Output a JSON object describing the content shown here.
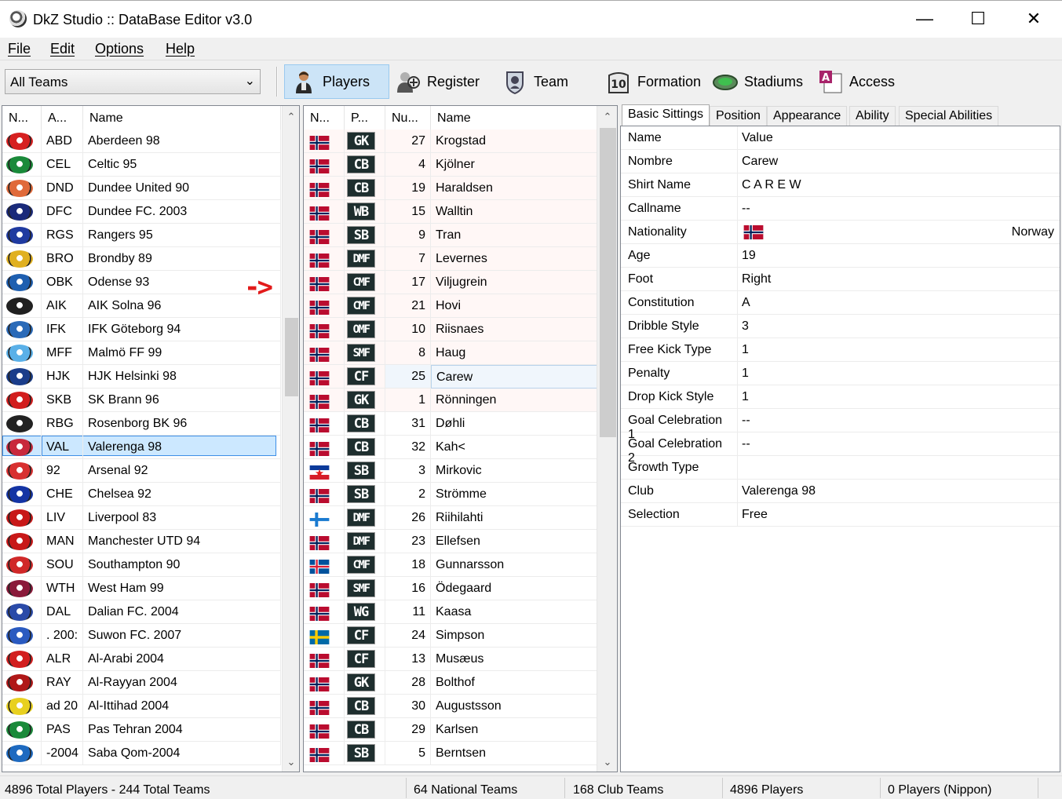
{
  "window": {
    "title": "DkZ Studio :: DataBase Editor v3.0",
    "minimize": "—",
    "maximize": "☐",
    "close": "✕"
  },
  "menu": [
    "File",
    "Edit",
    "Options",
    "Help"
  ],
  "toolbar": {
    "team_filter": "All Teams",
    "buttons": [
      {
        "label": "Players",
        "icon": "player-icon"
      },
      {
        "label": "Register",
        "icon": "register-icon"
      },
      {
        "label": "Team",
        "icon": "team-icon"
      },
      {
        "label": "Formation",
        "icon": "formation-icon"
      },
      {
        "label": "Stadiums",
        "icon": "stadium-icon"
      },
      {
        "label": "Access",
        "icon": "access-icon"
      }
    ]
  },
  "teams": {
    "columns": [
      "N...",
      "A...",
      "Name"
    ],
    "selected_index": 13,
    "rows": [
      {
        "abbr": "ABD",
        "name": "Aberdeen 98",
        "color": "#d62020"
      },
      {
        "abbr": "CEL",
        "name": "Celtic 95",
        "color": "#1a8a3a"
      },
      {
        "abbr": "DND",
        "name": "Dundee United 90",
        "color": "#e06a3a"
      },
      {
        "abbr": "DFC",
        "name": "Dundee FC. 2003",
        "color": "#1a2a7a"
      },
      {
        "abbr": "RGS",
        "name": "Rangers 95",
        "color": "#1f3aa0"
      },
      {
        "abbr": "BRO",
        "name": "Brondby 89",
        "color": "#e0b020"
      },
      {
        "abbr": "OBK",
        "name": "Odense 93",
        "color": "#1e5fb0"
      },
      {
        "abbr": "AIK",
        "name": "AIK Solna 96",
        "color": "#202020"
      },
      {
        "abbr": "IFK",
        "name": "IFK Göteborg 94",
        "color": "#2a6ab8"
      },
      {
        "abbr": "MFF",
        "name": "Malmö FF 99",
        "color": "#5ab0e8"
      },
      {
        "abbr": "HJK",
        "name": "HJK Helsinki 98",
        "color": "#1a3d8a"
      },
      {
        "abbr": "SKB",
        "name": "SK Brann 96",
        "color": "#d21e1e"
      },
      {
        "abbr": "RBG",
        "name": "Rosenborg BK 96",
        "color": "#222222"
      },
      {
        "abbr": "VAL",
        "name": "Valerenga 98",
        "color": "#c8283c"
      },
      {
        "abbr": "92",
        "name": "Arsenal 92",
        "color": "#d83030"
      },
      {
        "abbr": "CHE",
        "name": "Chelsea 92",
        "color": "#1434a4"
      },
      {
        "abbr": "LIV",
        "name": "Liverpool 83",
        "color": "#c81818"
      },
      {
        "abbr": "MAN",
        "name": "Manchester UTD 94",
        "color": "#c81818"
      },
      {
        "abbr": "SOU",
        "name": "Southampton 90",
        "color": "#d02828"
      },
      {
        "abbr": "WTH",
        "name": "West Ham 99",
        "color": "#8a1a3a"
      },
      {
        "abbr": "DAL",
        "name": "Dalian FC. 2004",
        "color": "#2a4aa8"
      },
      {
        "abbr": ". 200:",
        "name": "Suwon FC. 2007",
        "color": "#2a5ac0"
      },
      {
        "abbr": "ALR",
        "name": "Al-Arabi 2004",
        "color": "#d21e1e"
      },
      {
        "abbr": "RAY",
        "name": "Al-Rayyan 2004",
        "color": "#b01818"
      },
      {
        "abbr": "ad 20",
        "name": "Al-Ittihad 2004",
        "color": "#e8d020"
      },
      {
        "abbr": "PAS",
        "name": "Pas Tehran 2004",
        "color": "#1a8a3a"
      },
      {
        "abbr": "-2004",
        "name": "Saba Qom-2004",
        "color": "#1e6ac0"
      }
    ]
  },
  "players": {
    "columns": [
      "N...",
      "P...",
      "Nu...",
      "Name"
    ],
    "selected_index": 10,
    "rows": [
      {
        "flag": "NOR",
        "pos": "GK",
        "num": "27",
        "name": "Krogstad"
      },
      {
        "flag": "NOR",
        "pos": "CB",
        "num": "4",
        "name": "Kjölner"
      },
      {
        "flag": "NOR",
        "pos": "CB",
        "num": "19",
        "name": "Haraldsen"
      },
      {
        "flag": "NOR",
        "pos": "WB",
        "num": "15",
        "name": "Walltin"
      },
      {
        "flag": "NOR",
        "pos": "SB",
        "num": "9",
        "name": "Tran"
      },
      {
        "flag": "NOR",
        "pos": "DMF",
        "num": "7",
        "name": "Levernes"
      },
      {
        "flag": "NOR",
        "pos": "CMF",
        "num": "17",
        "name": "Viljugrein"
      },
      {
        "flag": "NOR",
        "pos": "CMF",
        "num": "21",
        "name": "Hovi"
      },
      {
        "flag": "NOR",
        "pos": "OMF",
        "num": "10",
        "name": "Riisnaes"
      },
      {
        "flag": "NOR",
        "pos": "SMF",
        "num": "8",
        "name": "Haug"
      },
      {
        "flag": "NOR",
        "pos": "CF",
        "num": "25",
        "name": "Carew"
      },
      {
        "flag": "NOR",
        "pos": "GK",
        "num": "1",
        "name": "Rönningen"
      },
      {
        "flag": "NOR",
        "pos": "CB",
        "num": "31",
        "name": "Døhli"
      },
      {
        "flag": "NOR",
        "pos": "CB",
        "num": "32",
        "name": "Kah<"
      },
      {
        "flag": "YUG",
        "pos": "SB",
        "num": "3",
        "name": "Mirkovic"
      },
      {
        "flag": "NOR",
        "pos": "SB",
        "num": "2",
        "name": "Strömme"
      },
      {
        "flag": "FIN",
        "pos": "DMF",
        "num": "26",
        "name": "Riihilahti"
      },
      {
        "flag": "NOR",
        "pos": "DMF",
        "num": "23",
        "name": "Ellefsen"
      },
      {
        "flag": "ISL",
        "pos": "CMF",
        "num": "18",
        "name": "Gunnarsson"
      },
      {
        "flag": "NOR",
        "pos": "SMF",
        "num": "16",
        "name": "Ödegaard"
      },
      {
        "flag": "NOR",
        "pos": "WG",
        "num": "11",
        "name": "Kaasa"
      },
      {
        "flag": "SWE",
        "pos": "CF",
        "num": "24",
        "name": "Simpson"
      },
      {
        "flag": "NOR",
        "pos": "CF",
        "num": "13",
        "name": "Musæus"
      },
      {
        "flag": "NOR",
        "pos": "GK",
        "num": "28",
        "name": "Bolthof"
      },
      {
        "flag": "NOR",
        "pos": "CB",
        "num": "30",
        "name": "Augustsson"
      },
      {
        "flag": "NOR",
        "pos": "CB",
        "num": "29",
        "name": "Karlsen"
      },
      {
        "flag": "NOR",
        "pos": "SB",
        "num": "5",
        "name": "Berntsen"
      }
    ]
  },
  "props": {
    "tabs": [
      "Basic Sittings",
      "Position",
      "Appearance",
      "Ability",
      "Special Abilities"
    ],
    "header": {
      "key": "Name",
      "value": "Value"
    },
    "rows": [
      {
        "key": "Nombre",
        "value": "Carew"
      },
      {
        "key": "Shirt Name",
        "value": "C A R E W"
      },
      {
        "key": "Callname",
        "value": "--"
      },
      {
        "key": "Nationality",
        "value": "Norway",
        "flag": "NOR"
      },
      {
        "key": "Age",
        "value": "19"
      },
      {
        "key": "Foot",
        "value": "Right"
      },
      {
        "key": "Constitution",
        "value": "A"
      },
      {
        "key": "Dribble Style",
        "value": "3"
      },
      {
        "key": "Free Kick Type",
        "value": "1"
      },
      {
        "key": "Penalty",
        "value": "1"
      },
      {
        "key": "Drop Kick Style",
        "value": "1"
      },
      {
        "key": "Goal Celebration 1",
        "value": "--"
      },
      {
        "key": "Goal Celebration 2",
        "value": "--"
      },
      {
        "key": "Growth Type",
        "value": ""
      },
      {
        "key": "Club",
        "value": "Valerenga 98"
      },
      {
        "key": "Selection",
        "value": "Free"
      }
    ]
  },
  "status": [
    "4896 Total Players  -  244 Total Teams",
    "64 National Teams",
    "168 Club Teams",
    "4896 Players",
    "0 Players (Nippon)"
  ],
  "annotation": "->",
  "colors": {
    "selection": "#cce8ff",
    "selection_border": "#3d8ee6",
    "accent": "#cce4f7"
  }
}
